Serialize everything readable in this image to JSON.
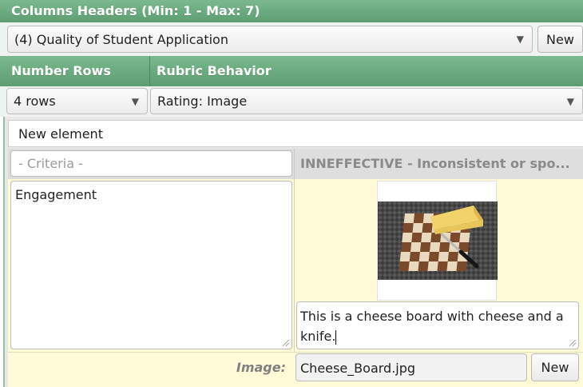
{
  "columns_header": {
    "title": "Columns Headers (Min: 1 - Max: 7)",
    "select_value": "(4) Quality of Student Application",
    "new_button": "New"
  },
  "sub_header": {
    "number_rows_label": "Number Rows",
    "rubric_behavior_label": "Rubric Behavior",
    "rows_value": "4 rows",
    "behavior_value": "Rating: Image"
  },
  "element": {
    "name_value": "New element",
    "criteria_placeholder": "- Criteria -",
    "column_header": "INNEFFECTIVE - Inconsistent or spo...",
    "criteria_value": "Engagement",
    "image_caption": "This is a cheese board with cheese and a knife.",
    "image_label": "Image:",
    "image_filename": "Cheese_Board.jpg",
    "image_new_button": "New"
  },
  "colors": {
    "header_green": "#5c9e72",
    "cell_yellow": "#fffbd8",
    "label_gray": "#808080"
  }
}
